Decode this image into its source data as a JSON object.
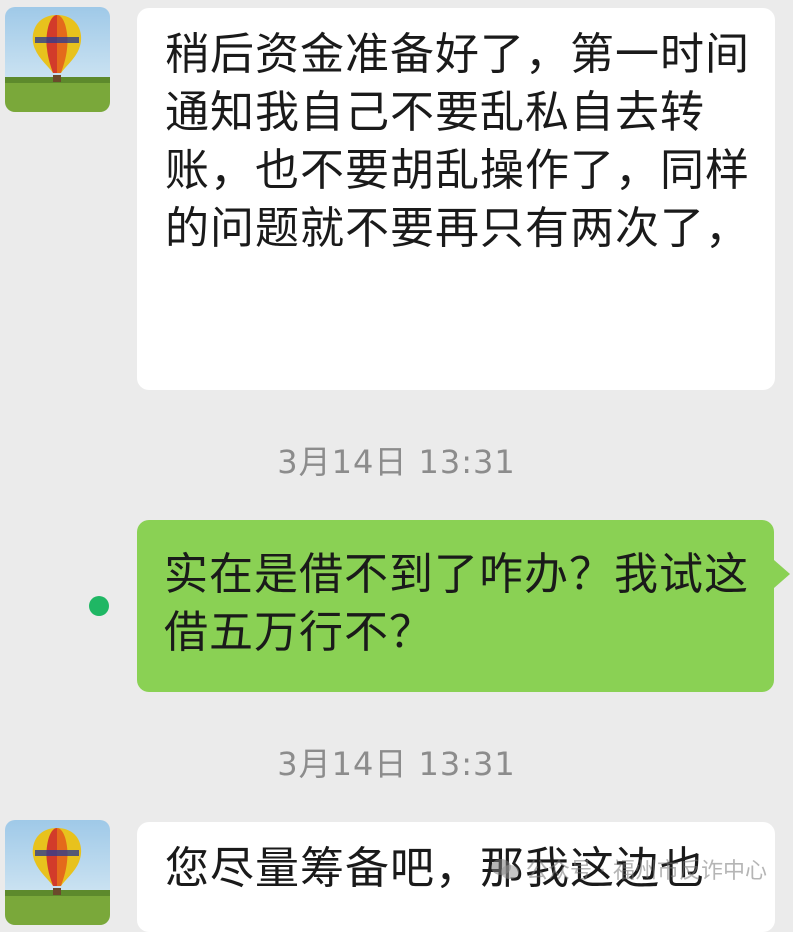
{
  "messages": [
    {
      "direction": "incoming",
      "text": "稍后资金准备好了，第一时间通知我自己不要乱私自去转账，也不要胡乱操作了，同样的问题就不要再只有两次了，"
    },
    {
      "direction": "outgoing",
      "text": "实在是借不到了咋办？我试这借五万行不？"
    },
    {
      "direction": "incoming",
      "text": "您尽量筹备吧，那我这边也"
    }
  ],
  "timestamps": [
    "3月14日 13:31",
    "3月14日 13:31"
  ],
  "watermark": {
    "text": "公众号 · 福州市反诈中心",
    "icon": "wechat-icon"
  },
  "colors": {
    "background": "#ebebeb",
    "incoming_bubble": "#ffffff",
    "outgoing_bubble": "#8ad154",
    "status_dot": "#1fb764",
    "timestamp": "#8c8c8c"
  }
}
